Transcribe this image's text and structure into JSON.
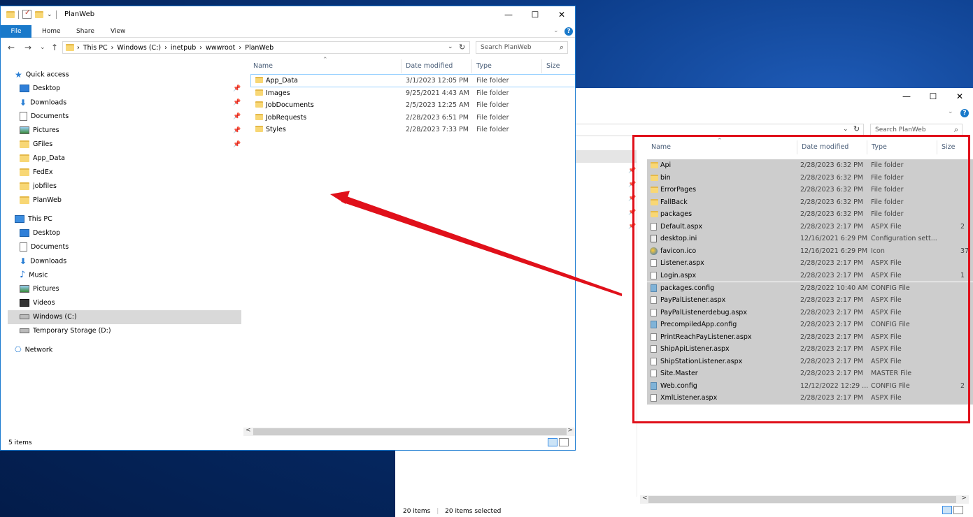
{
  "front": {
    "title": "PlanWeb",
    "ribbon": {
      "file": "File",
      "home": "Home",
      "share": "Share",
      "view": "View"
    },
    "controls": {
      "minimize": "—",
      "maximize": "☐",
      "close": "✕"
    },
    "nav": {
      "back": "←",
      "forward": "→",
      "recent": "⌄",
      "up": "↑"
    },
    "breadcrumb": [
      "This PC",
      "Windows (C:)",
      "inetpub",
      "wwwroot",
      "PlanWeb"
    ],
    "crumb_sep": "›",
    "search_placeholder": "Search PlanWeb",
    "columns": {
      "name": "Name",
      "date": "Date modified",
      "type": "Type",
      "size": "Size"
    },
    "sidebar": {
      "quick_access": "Quick access",
      "quick_items": [
        "Desktop",
        "Downloads",
        "Documents",
        "Pictures",
        "GFiles",
        "App_Data",
        "FedEx",
        "jobfiles",
        "PlanWeb"
      ],
      "this_pc": "This PC",
      "pc_items": [
        "Desktop",
        "Documents",
        "Downloads",
        "Music",
        "Pictures",
        "Videos",
        "Windows (C:)",
        "Temporary Storage (D:)"
      ],
      "network": "Network"
    },
    "files": [
      {
        "name": "App_Data",
        "date": "3/1/2023 12:05 PM",
        "type": "File folder"
      },
      {
        "name": "Images",
        "date": "9/25/2021 4:43 AM",
        "type": "File folder"
      },
      {
        "name": "JobDocuments",
        "date": "2/5/2023 12:25 AM",
        "type": "File folder"
      },
      {
        "name": "JobRequests",
        "date": "2/28/2023 6:51 PM",
        "type": "File folder"
      },
      {
        "name": "Styles",
        "date": "2/28/2023 7:33 PM",
        "type": "File folder"
      }
    ],
    "status": "5 items"
  },
  "back": {
    "controls": {
      "minimize": "—",
      "maximize": "☐",
      "close": "✕"
    },
    "search_placeholder": "Search PlanWeb",
    "columns": {
      "name": "Name",
      "date": "Date modified",
      "type": "Type",
      "size": "Size"
    },
    "files": [
      {
        "name": "Api",
        "date": "2/28/2023 6:32 PM",
        "type": "File folder",
        "size": "",
        "kind": "folder"
      },
      {
        "name": "bin",
        "date": "2/28/2023 6:32 PM",
        "type": "File folder",
        "size": "",
        "kind": "folder"
      },
      {
        "name": "ErrorPages",
        "date": "2/28/2023 6:32 PM",
        "type": "File folder",
        "size": "",
        "kind": "folder"
      },
      {
        "name": "FallBack",
        "date": "2/28/2023 6:32 PM",
        "type": "File folder",
        "size": "",
        "kind": "folder"
      },
      {
        "name": "packages",
        "date": "2/28/2023 6:32 PM",
        "type": "File folder",
        "size": "",
        "kind": "folder"
      },
      {
        "name": "Default.aspx",
        "date": "2/28/2023 2:17 PM",
        "type": "ASPX File",
        "size": "2",
        "kind": "file"
      },
      {
        "name": "desktop.ini",
        "date": "12/16/2021 6:29 PM",
        "type": "Configuration sett...",
        "size": "",
        "kind": "ini"
      },
      {
        "name": "favicon.ico",
        "date": "12/16/2021 6:29 PM",
        "type": "Icon",
        "size": "37",
        "kind": "ico"
      },
      {
        "name": "Listener.aspx",
        "date": "2/28/2023 2:17 PM",
        "type": "ASPX File",
        "size": "",
        "kind": "file"
      },
      {
        "name": "Login.aspx",
        "date": "2/28/2023 2:17 PM",
        "type": "ASPX File",
        "size": "1",
        "kind": "file"
      },
      {
        "name": "packages.config",
        "date": "2/28/2022 10:40 AM",
        "type": "CONFIG File",
        "size": "",
        "kind": "cfg"
      },
      {
        "name": "PayPalListener.aspx",
        "date": "2/28/2023 2:17 PM",
        "type": "ASPX File",
        "size": "",
        "kind": "file"
      },
      {
        "name": "PayPalListenerdebug.aspx",
        "date": "2/28/2023 2:17 PM",
        "type": "ASPX File",
        "size": "",
        "kind": "file"
      },
      {
        "name": "PrecompiledApp.config",
        "date": "2/28/2023 2:17 PM",
        "type": "CONFIG File",
        "size": "",
        "kind": "cfg"
      },
      {
        "name": "PrintReachPayListener.aspx",
        "date": "2/28/2023 2:17 PM",
        "type": "ASPX File",
        "size": "",
        "kind": "file"
      },
      {
        "name": "ShipApiListener.aspx",
        "date": "2/28/2023 2:17 PM",
        "type": "ASPX File",
        "size": "",
        "kind": "file"
      },
      {
        "name": "ShipStationListener.aspx",
        "date": "2/28/2023 2:17 PM",
        "type": "ASPX File",
        "size": "",
        "kind": "file"
      },
      {
        "name": "Site.Master",
        "date": "2/28/2023 2:17 PM",
        "type": "MASTER File",
        "size": "",
        "kind": "file"
      },
      {
        "name": "Web.config",
        "date": "12/12/2022 12:29 ...",
        "type": "CONFIG File",
        "size": "2",
        "kind": "cfg"
      },
      {
        "name": "XmlListener.aspx",
        "date": "2/28/2023 2:17 PM",
        "type": "ASPX File",
        "size": "",
        "kind": "file"
      }
    ],
    "status_count": "20 items",
    "status_selected": "20 items selected"
  },
  "colors": {
    "accent": "#1979ca",
    "highlight": "#e0101a",
    "selection": "#cdcdcd"
  },
  "icons": {
    "pin": "📌",
    "search": "⌕",
    "refresh": "↻",
    "dropdown": "⌄",
    "help": "?",
    "sort_caret": "⌃",
    "scroll_left": "<",
    "scroll_right": ">"
  }
}
